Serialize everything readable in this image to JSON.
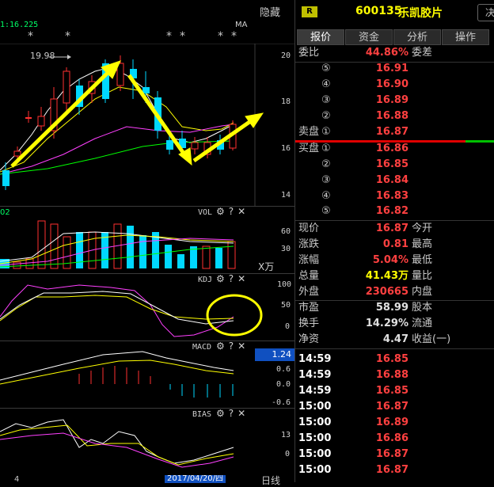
{
  "header": {
    "ma_label": "1:16.225",
    "ma_tag": "MA",
    "hide_label": "隐藏",
    "stars": [
      "*",
      "*",
      "*",
      "*",
      "*",
      "*",
      "*"
    ]
  },
  "kline": {
    "high_mark": "19.98",
    "y_ticks": [
      "20",
      "18",
      "16",
      "14"
    ]
  },
  "vol": {
    "title": "VOL",
    "left_label": "02",
    "y_ticks": [
      "60",
      "30"
    ],
    "unit": "X万"
  },
  "kdj": {
    "title": "KDJ",
    "y_ticks": [
      "100",
      "50",
      "0"
    ]
  },
  "macd": {
    "title": "MACD",
    "value_badge": "1.24",
    "y_ticks": [
      "0.6",
      "0.0",
      "-0.6"
    ]
  },
  "bias": {
    "title": "BIAS",
    "y_ticks": [
      "13",
      "0"
    ]
  },
  "footer": {
    "date": "2017/04/20/四",
    "period": "日线",
    "left_mark": "4"
  },
  "icons": {
    "gear": "⚙",
    "help": "?",
    "close": "✕"
  },
  "quote": {
    "badge": "R",
    "code": "600135",
    "name": "乐凯胶片",
    "decide_label": "决",
    "tabs": [
      "报价",
      "资金",
      "分析",
      "操作"
    ],
    "weibi_label": "委比",
    "weibi_value": "44.86%",
    "weicha_label": "委差",
    "asks": [
      {
        "num": "⑤",
        "price": "16.91"
      },
      {
        "num": "④",
        "price": "16.90"
      },
      {
        "num": "③",
        "price": "16.89"
      },
      {
        "num": "②",
        "price": "16.88"
      },
      {
        "num": "①",
        "price": "16.87"
      }
    ],
    "sell_label": "卖盘",
    "buy_label": "买盘",
    "bids": [
      {
        "num": "①",
        "price": "16.86"
      },
      {
        "num": "②",
        "price": "16.85"
      },
      {
        "num": "③",
        "price": "16.84"
      },
      {
        "num": "④",
        "price": "16.83"
      },
      {
        "num": "⑤",
        "price": "16.82"
      }
    ],
    "stats": [
      {
        "label": "现价",
        "value": "16.87",
        "label2": "今开",
        "color": "red"
      },
      {
        "label": "涨跌",
        "value": "0.81",
        "label2": "最高",
        "color": "red"
      },
      {
        "label": "涨幅",
        "value": "5.04%",
        "label2": "最低",
        "color": "red"
      },
      {
        "label": "总量",
        "value": "41.43万",
        "label2": "量比",
        "color": "yellow"
      },
      {
        "label": "外盘",
        "value": "230665",
        "label2": "内盘",
        "color": "red"
      }
    ],
    "stats2": [
      {
        "label": "市盈",
        "value": "58.99",
        "label2": "股本",
        "color": "plain"
      },
      {
        "label": "换手",
        "value": "14.29%",
        "label2": "流通",
        "color": "plain"
      },
      {
        "label": "净资",
        "value": "4.47",
        "label2": "收益(一)",
        "color": "plain"
      }
    ],
    "ticks": [
      {
        "time": "14:59",
        "price": "16.85"
      },
      {
        "time": "14:59",
        "price": "16.88"
      },
      {
        "time": "14:59",
        "price": "16.85"
      },
      {
        "time": "15:00",
        "price": "16.87"
      },
      {
        "time": "15:00",
        "price": "16.89"
      },
      {
        "time": "15:00",
        "price": "16.86"
      },
      {
        "time": "15:00",
        "price": "16.87"
      },
      {
        "time": "15:00",
        "price": "16.87"
      }
    ]
  },
  "colors": {
    "up": "#ff3030",
    "down": "#00d8ff",
    "ma1": "#ffffff",
    "ma2": "#ffff00",
    "ma3": "#ff40ff",
    "ma4": "#00ff00",
    "annotation": "#ffff00"
  }
}
